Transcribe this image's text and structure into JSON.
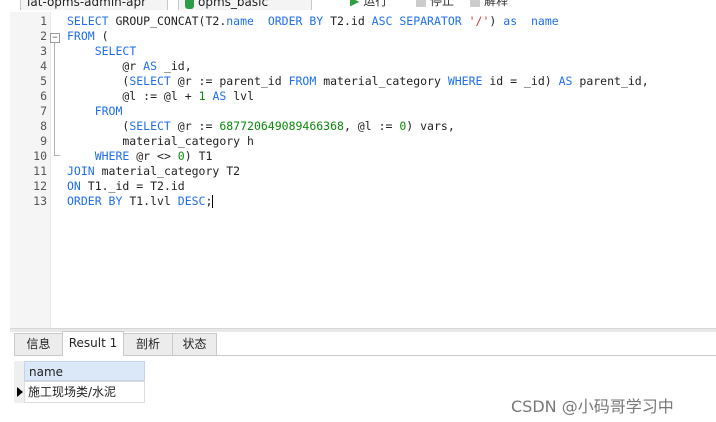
{
  "toolbar": {
    "connection_tab": "lat-opms-admin-apr",
    "database_tab": "opms_basic",
    "run_label": "运行",
    "stop_label": "停止",
    "explain_label": "解释"
  },
  "editor": {
    "lines": [
      "1",
      "2",
      "3",
      "4",
      "5",
      "6",
      "7",
      "8",
      "9",
      "10",
      "11",
      "12",
      "13"
    ]
  },
  "bottom_tabs": [
    "信息",
    "Result 1",
    "剖析",
    "状态"
  ],
  "result_grid": {
    "columns": [
      "name"
    ],
    "rows": [
      [
        "施工现场类/水泥"
      ]
    ]
  },
  "watermark": "CSDN @小码哥学习中"
}
